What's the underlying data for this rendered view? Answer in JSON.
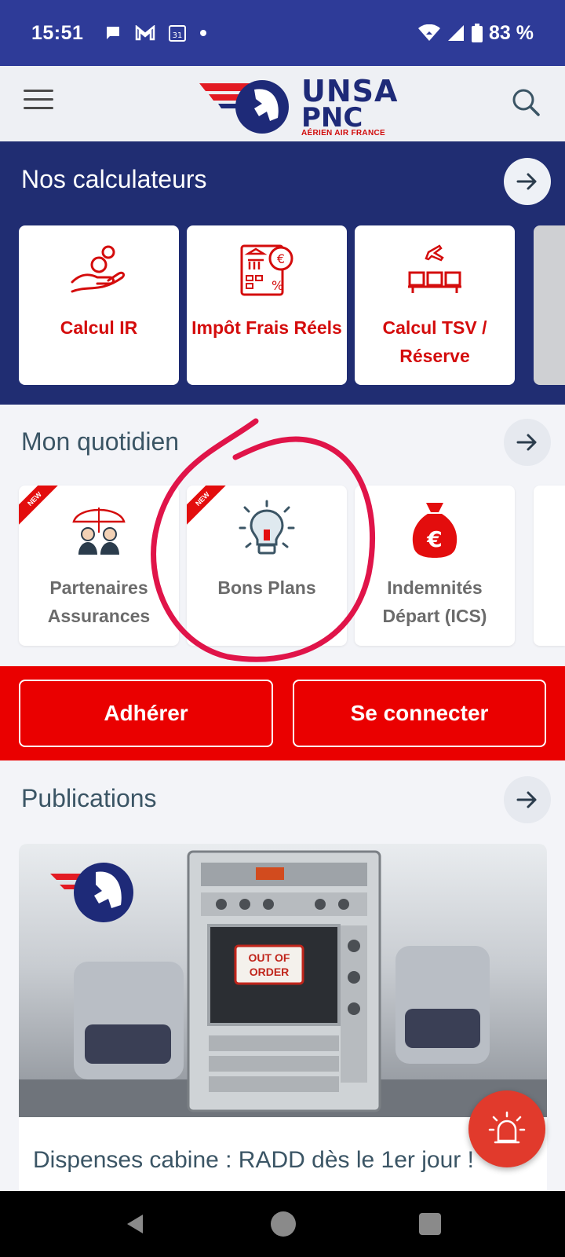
{
  "status_bar": {
    "time": "15:51",
    "battery": "83 %"
  },
  "header": {
    "logo": {
      "line1": "UNSA",
      "line2": "PNC",
      "line3": "AÉRIEN AIR FRANCE"
    }
  },
  "calculateurs": {
    "title": "Nos calculateurs",
    "items": [
      {
        "label": "Calcul IR",
        "icon": "hand-coins-icon"
      },
      {
        "label": "Impôt Frais Réels",
        "icon": "tax-calculator-icon"
      },
      {
        "label": "Calcul TSV / Réserve",
        "icon": "airport-seats-icon"
      }
    ]
  },
  "quotidien": {
    "title": "Mon quotidien",
    "items": [
      {
        "label": "Partenaires Assurances",
        "badge": "NEW",
        "icon": "insurance-umbrella-icon"
      },
      {
        "label": "Bons Plans",
        "badge": "NEW",
        "icon": "lightbulb-icon"
      },
      {
        "label": "Indemnités Départ (ICS)",
        "icon": "euro-bag-icon"
      }
    ]
  },
  "actions": {
    "join": "Adhérer",
    "login": "Se connecter"
  },
  "publications": {
    "title": "Publications",
    "card": {
      "title": "Dispenses cabine : RADD dès le 1er jour !",
      "image_sign": "OUT OF ORDER"
    }
  },
  "colors": {
    "brand_navy": "#202d72",
    "brand_red": "#ea0000",
    "status_bar": "#2e3b98"
  }
}
